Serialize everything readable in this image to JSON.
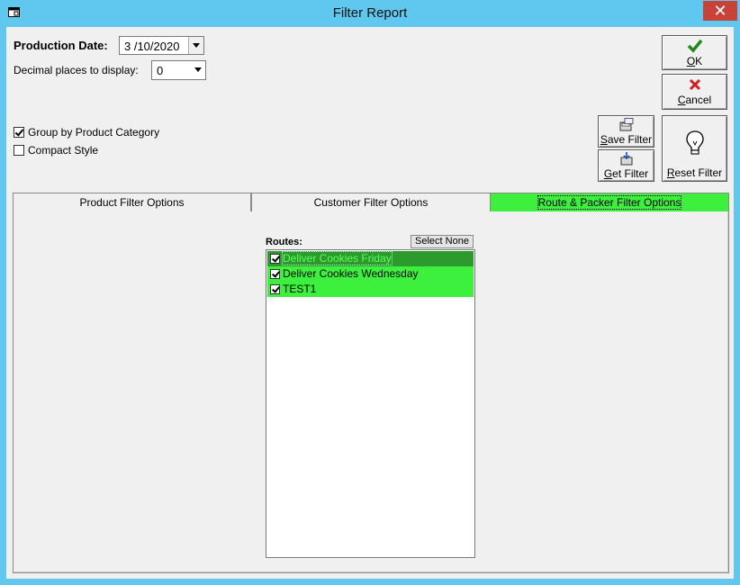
{
  "window": {
    "title": "Filter Report",
    "close_glyph": "✕",
    "icon": "app-window-icon"
  },
  "header": {
    "production_date_label": "Production Date:",
    "production_date_value": "3 /10/2020",
    "decimal_label": "Decimal places to display:",
    "decimal_value": "0"
  },
  "options": {
    "group_by_category": {
      "label": "Group by Product Category",
      "checked": true
    },
    "compact_style": {
      "label": "Compact Style",
      "checked": false
    }
  },
  "buttons": {
    "ok": {
      "label_underlined": "O",
      "label_rest": "K",
      "icon": "checkmark-icon"
    },
    "cancel": {
      "label_underlined": "C",
      "label_rest": "ancel",
      "icon": "x-icon"
    },
    "save_filter": {
      "label_underlined": "S",
      "label_rest": "ave Filter",
      "icon": "save-disk-icon"
    },
    "get_filter": {
      "label_underlined": "G",
      "label_rest": "et Filter",
      "icon": "get-disk-icon"
    },
    "reset_filter": {
      "label_underlined": "R",
      "label_rest": "eset Filter",
      "icon": "lightbulb-icon"
    }
  },
  "tabs": [
    {
      "label": "Product Filter Options",
      "active": false
    },
    {
      "label": "Customer Filter Options",
      "active": false
    },
    {
      "label": "Route & Packer Filter Options",
      "active": true
    }
  ],
  "routes": {
    "label": "Routes:",
    "select_none_label": "Select None",
    "items": [
      {
        "label": "Deliver Cookies Friday",
        "checked": true,
        "selected": true
      },
      {
        "label": "Deliver Cookies Wednesday",
        "checked": true,
        "selected": false
      },
      {
        "label": "TEST1",
        "checked": true,
        "selected": false
      }
    ]
  },
  "colors": {
    "accent_green": "#3ef03e",
    "selected_green": "#2c9a2c",
    "titlebar": "#60c8ee",
    "close_red": "#c9423a"
  }
}
